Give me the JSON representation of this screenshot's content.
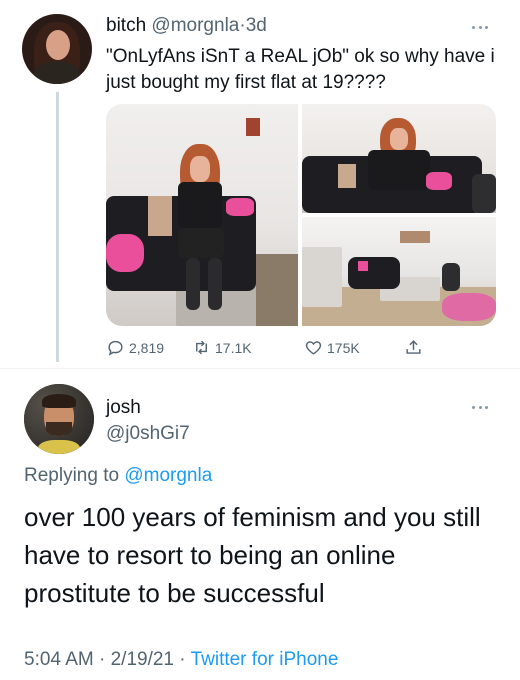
{
  "tweet": {
    "author_name": "bitch",
    "author_handle": "@morgnla",
    "separator": "·",
    "age": "3d",
    "text": "\"OnLyfAns iSnT a ReAL jOb\" ok so why have i just bought my first flat at 19????",
    "actions": {
      "reply_count": "2,819",
      "retweet_count": "17.1K",
      "like_count": "175K"
    }
  },
  "reply": {
    "author_name": "josh",
    "author_handle": "@j0shGi7",
    "replying_prefix": "Replying to",
    "replying_to": "@morgnla",
    "text": "over 100 years of feminism and you still have to resort to being an online prostitute to be successful",
    "time": "5:04 AM",
    "separator1": "·",
    "date": "2/19/21",
    "separator2": "·",
    "source": "Twitter for iPhone"
  },
  "colors": {
    "link": "#1d9bf0",
    "secondary_text": "#536471",
    "primary_text": "#0f1419"
  },
  "icons": [
    "more-icon",
    "reply-icon",
    "retweet-icon",
    "like-icon",
    "share-icon"
  ]
}
